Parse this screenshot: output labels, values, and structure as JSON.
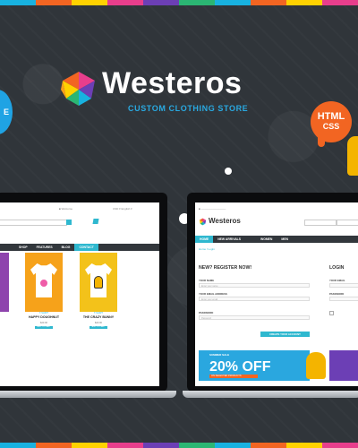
{
  "colors": {
    "stripe": [
      "#18b2e0",
      "#f26522",
      "#ffd200",
      "#e83e8c",
      "#6c3fb5",
      "#2bb673",
      "#18b2e0",
      "#f26522",
      "#ffd200",
      "#e83e8c"
    ],
    "accent": "#2fb8cf",
    "brand_blue": "#29a9e1",
    "background": "#30353a"
  },
  "brand": {
    "name": "Westeros",
    "tagline": "CUSTOM CLOTHING STORE"
  },
  "badges": {
    "html_line1": "HTML",
    "html_line2": "CSS",
    "left_partial": "E"
  },
  "left_screen": {
    "nav": [
      "SHOP",
      "FEATURES",
      "BLOG",
      "CONTACT"
    ],
    "products": [
      {
        "name": "HAPPY DOUGHNUT",
        "category": "T-SHIRT",
        "price": "$20.00",
        "button": "ADD TO CART",
        "bg": "#f6a21a",
        "icon": "doughnut-icon"
      },
      {
        "name": "THE CRAZY BUNNY",
        "category": "T-SHIRT",
        "price": "$20.00",
        "button": "ADD TO CART",
        "bg": "#f3c21a",
        "icon": "monster-icon"
      }
    ]
  },
  "right_screen": {
    "logo": "Westeros",
    "nav": [
      "HOME",
      "NEW ARRIVALS",
      "WOMEN",
      "MEN"
    ],
    "register_title": "NEW? REGISTER NOW!",
    "login_title": "LOGIN",
    "fields": [
      {
        "label": "YOUR NAME",
        "placeholder": "Enter your name"
      },
      {
        "label": "YOUR EMAIL ADDRESS",
        "placeholder": "Enter your email"
      },
      {
        "label": "PASSWORD",
        "placeholder": "Password"
      }
    ],
    "login_fields": [
      {
        "label": "YOUR EMAIL"
      },
      {
        "label": "PASSWORD"
      }
    ],
    "create_button": "CREATE YOUR ACCOUNT",
    "promo": {
      "big": "20% OFF",
      "small": "SUMMER SALE",
      "strip": "ON SELECTED PRODUCTS"
    }
  }
}
